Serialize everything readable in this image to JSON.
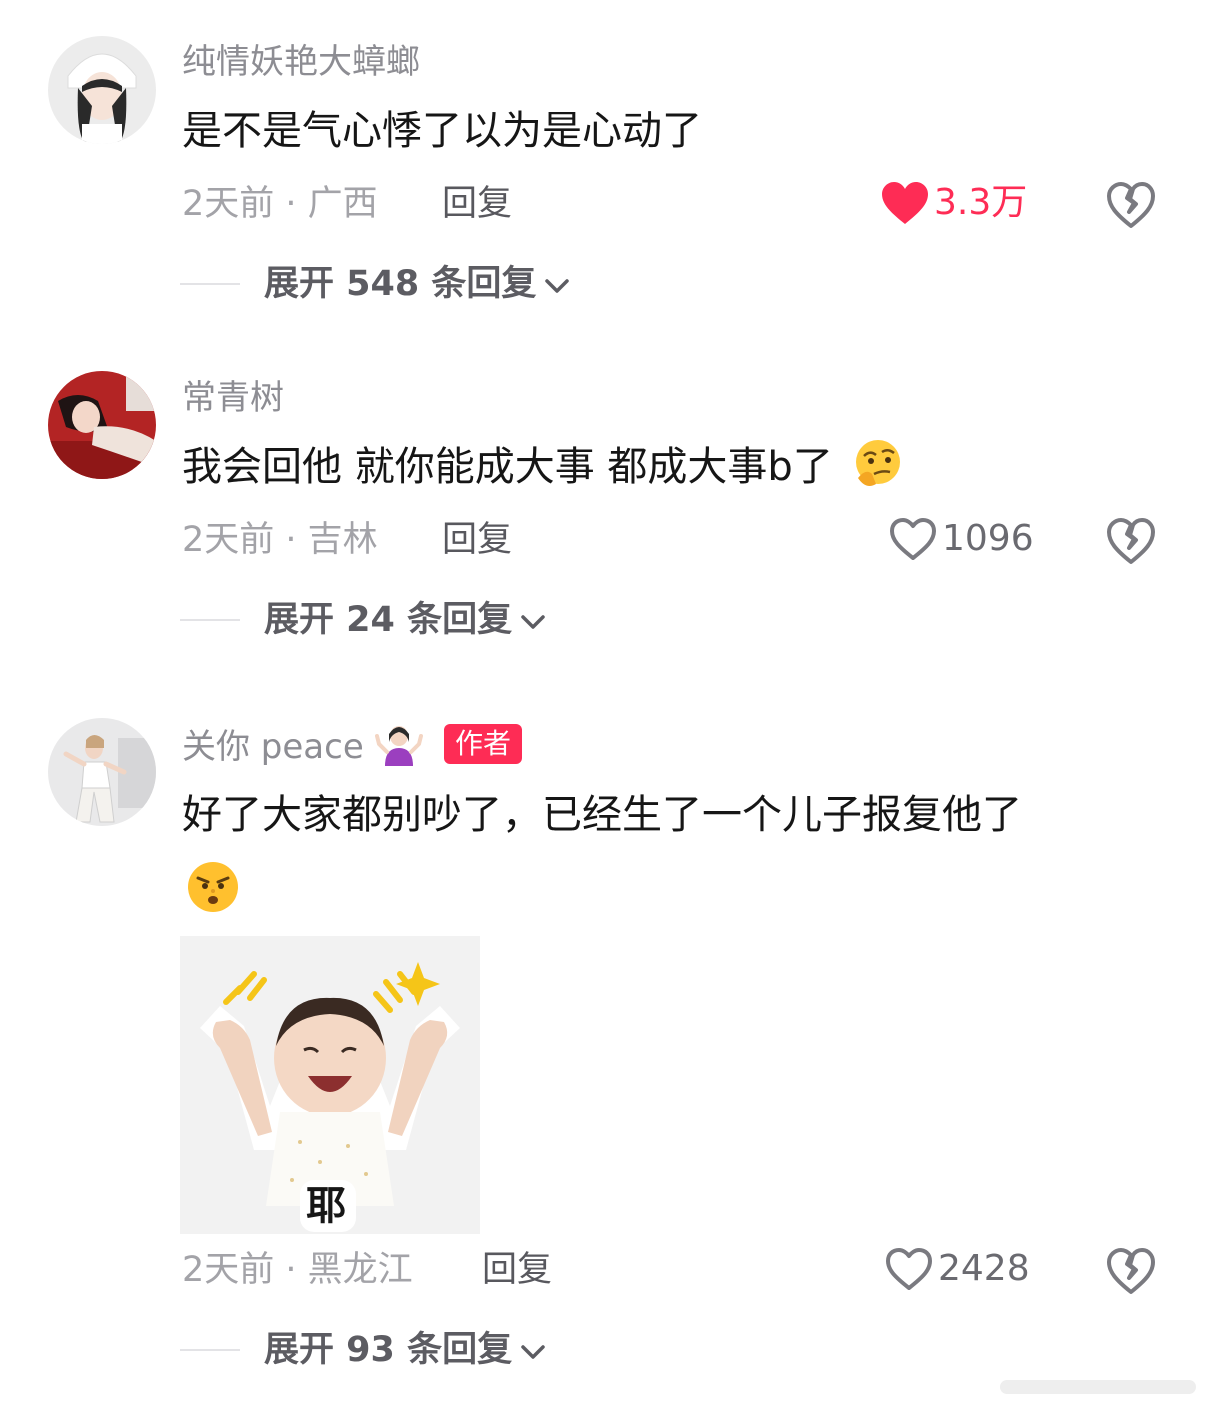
{
  "colors": {
    "accent": "#fe2c55",
    "username": "#8d8d93",
    "meta": "#a3a3a8",
    "text": "#161616"
  },
  "comments": [
    {
      "username": "纯情妖艳大蟑螂",
      "text": "是不是气心悸了以为是心动了",
      "time_location": "2天前 · 广西",
      "reply_label": "回复",
      "likes": "3.3万",
      "liked": true,
      "expand_label": "展开 548 条回复",
      "avatar_icon": "avatar-girl-white-hat"
    },
    {
      "username": "常青树",
      "text": "我会回他 就你能成大事 都成大事b了",
      "emoji": "thinking-face-emoji",
      "time_location": "2天前 · 吉林",
      "reply_label": "回复",
      "likes": "1096",
      "liked": false,
      "expand_label": "展开 24 条回复",
      "avatar_icon": "avatar-girl-red-sofa"
    },
    {
      "username": "关你 peace",
      "username_emoji": "shrug-emoji",
      "badge": "作者",
      "text": "好了大家都别吵了，已经生了一个儿子报复他了",
      "text_emoji": "smirk-face-emoji",
      "sticker_caption": "耶",
      "time_location": "2天前 · 黑龙江",
      "reply_label": "回复",
      "likes": "2428",
      "liked": false,
      "expand_label": "展开 93 条回复",
      "avatar_icon": "avatar-girl-dancing"
    }
  ]
}
